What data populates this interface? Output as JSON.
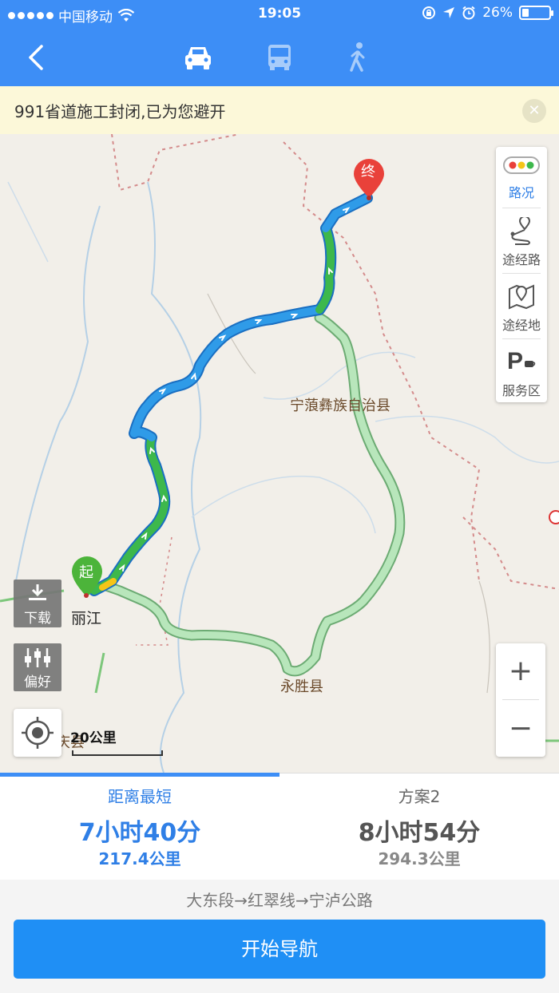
{
  "status_bar": {
    "carrier": "中国移动",
    "time": "19:05",
    "battery": "26%",
    "battery_level": 0.26
  },
  "header": {
    "back_icon": "chevron-left-icon",
    "modes": [
      {
        "icon": "car-icon",
        "active": true
      },
      {
        "icon": "bus-icon",
        "active": false
      },
      {
        "icon": "walk-icon",
        "active": false
      }
    ]
  },
  "notice": {
    "text": "991省道施工封闭,已为您避开",
    "close_icon": "close-icon"
  },
  "map": {
    "start_marker": "起",
    "end_marker": "终",
    "labels": {
      "county_ninglang": "宁蒗彝族自治县",
      "county_yongsheng": "永胜县",
      "city_lijiang": "丽江",
      "partial_county": "庆县"
    },
    "scale": "20公里",
    "side_panel": {
      "traffic": "路况",
      "waypoint_route": "途经路",
      "waypoint_place": "途经地",
      "service_area": "服务区"
    },
    "tools": {
      "download": "下载",
      "preference": "偏好"
    },
    "zoom_in": "+",
    "zoom_out": "−"
  },
  "routes": [
    {
      "name": "距离最短",
      "time": "7小时40分",
      "distance": "217.4公里",
      "active": true
    },
    {
      "name": "方案2",
      "time": "8小时54分",
      "distance": "294.3公里",
      "active": false
    }
  ],
  "via_roads": "大东段→红翠线→宁泸公路",
  "start_navigation": "开始导航",
  "colors": {
    "primary": "#3d8ef6",
    "route_blue": "#2f8de8",
    "route_green": "#33b24a",
    "route_alt": "#a9dfae",
    "notice_bg": "#fcf8d9"
  }
}
